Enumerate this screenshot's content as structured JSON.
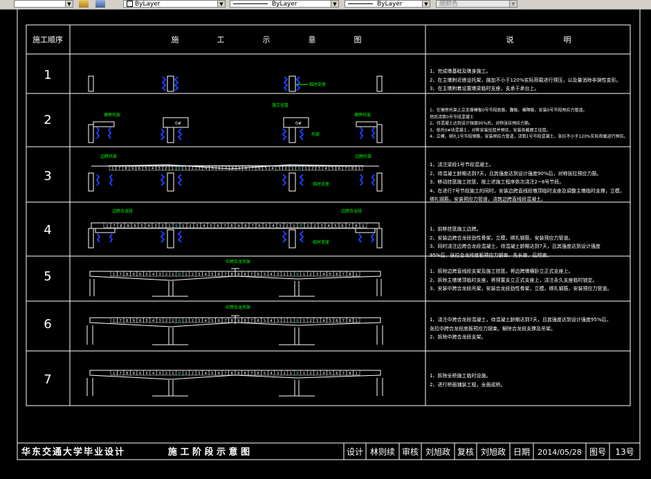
{
  "toolbar": {
    "layer_combo": "ByLayer",
    "linetype_combo": "ByLayer",
    "lineweight_combo": "ByLayer",
    "plotstyle_combo": "随颜色"
  },
  "table": {
    "header_seq": "施工顺序",
    "header_diagram": [
      "施",
      "工",
      "示",
      "意",
      "图"
    ],
    "header_notes": [
      "说",
      "明"
    ]
  },
  "steps": [
    {
      "num": "1",
      "notes": [
        "1、完成墩基础及墩身施工。",
        "2、在主墩附近搭设托架，施加不小于120%实际荷载进行预压，以及量消除非弹性变形。",
        "3、在主墩附着设置墩梁临时支座，支承于承台上。"
      ]
    },
    {
      "num": "2",
      "notes": [
        "1、在墩旁托架上立支撑模板0号节段底板、腹板、横隔板，安装0号节段预应力管道。",
        "然后浇筑0号节段混凝土",
        "2、待混凝土达到设计强度90%后，对称张拉预应力筋。",
        "3、依托0#块混凝土，对称安装挂篮并预压，安装各截面工挂篮。",
        "4、立模，绑扎1号节段钢筋，安装预应力管道，浇筑1号节段混凝土，张拉不小于120%实际荷载进行预压。"
      ],
      "labels": [
        "墩旁托架",
        "施工挂篮",
        "托架",
        "墩旁托架"
      ]
    },
    {
      "num": "3",
      "notes": [
        "1、浇注梁段1号节段混凝土。",
        "2、待混凝土龄期达到7天，且其强度达到设计强度90%后，对称张拉预应力筋。",
        "3、移动挂篮施工挂篮，按上述施工程序依次浇注2~8号节段。",
        "4、在进行7号节段施工的同时，安装边跨直线段墩顶临时支座及调整主墩临时支撑，立模，",
        "绑扎钢筋，安装预应力管道，浇筑边跨直线段混凝土。"
      ],
      "labels": [
        "边跨托架",
        "边跨托架",
        "临时支座"
      ]
    },
    {
      "num": "4",
      "notes": [
        "1、前移挂篮施工边跨。",
        "2、安装边跨合龙段劲性骨架，立模，绑扎钢筋，安装预应力管道。",
        "3、同时浇注边跨合龙段混凝土，待混凝土龄期达到7天，且其强度达到设计强度",
        "95%后，张拉合龙段底板预应力钢束，先长束，后短束。"
      ],
      "labels": [
        "边跨合龙段",
        "边跨合龙段",
        "临时支座"
      ]
    },
    {
      "num": "5",
      "notes": [
        "1、拆除边跨直线段支架及施工挂篮，将边跨墩横卧立正式支座上。",
        "2、拆除主墩墩顶临时支座，将预置支立正式支座上，浇注永久支座临时锁定。",
        "3、安装中跨合龙段吊架，安装合龙段劲性骨架，立模，绑扎钢筋，安装预应力管道。"
      ],
      "labels": [
        "中跨合龙吊架"
      ]
    },
    {
      "num": "6",
      "notes": [
        "1、浇注中跨合龙段混凝土，待混凝土龄期达到7天，且其强度达到设计强度95%后，",
        "张拉中跨合龙段底板预应力钢束。解除合龙段支撑及吊架。",
        "2、拆除中跨合龙段支架。"
      ],
      "labels": [
        "中跨合龙吊架"
      ]
    },
    {
      "num": "7",
      "notes": [
        "1、拆除全桥施工临时设施。",
        "2、进行桥面铺装工程，全面成桥。"
      ]
    }
  ],
  "segments_main": [
    "1",
    "7",
    "8",
    "9",
    "6",
    "5",
    "4",
    "3",
    "2",
    "1",
    "0",
    "1",
    "2",
    "3",
    "4",
    "5",
    "6",
    "7",
    "8",
    "9",
    "8",
    "7",
    "6",
    "5",
    "4",
    "3",
    "2",
    "1",
    "0",
    "1",
    "2",
    "3",
    "4",
    "5",
    "6",
    "7",
    "8",
    "1"
  ],
  "title_block": {
    "school": "华东交通大学毕业设计",
    "drawing_title": "施 工 阶 段 示 意 图",
    "design_label": "设计",
    "designer": "林则续",
    "review_label": "审核",
    "reviewer": "刘旭政",
    "recheck_label": "复核",
    "rechecker": "刘旭政",
    "date_label": "日期",
    "date": "2014/05/28",
    "sheet_label": "图号",
    "sheet_no": "13号"
  },
  "colors": {
    "background": "#000000",
    "lines": "#ffffff",
    "blue_piers": "#1b3fff",
    "green_labels": "#00ff00",
    "magenta": "#ff00ff",
    "cyan": "#00ffff"
  }
}
